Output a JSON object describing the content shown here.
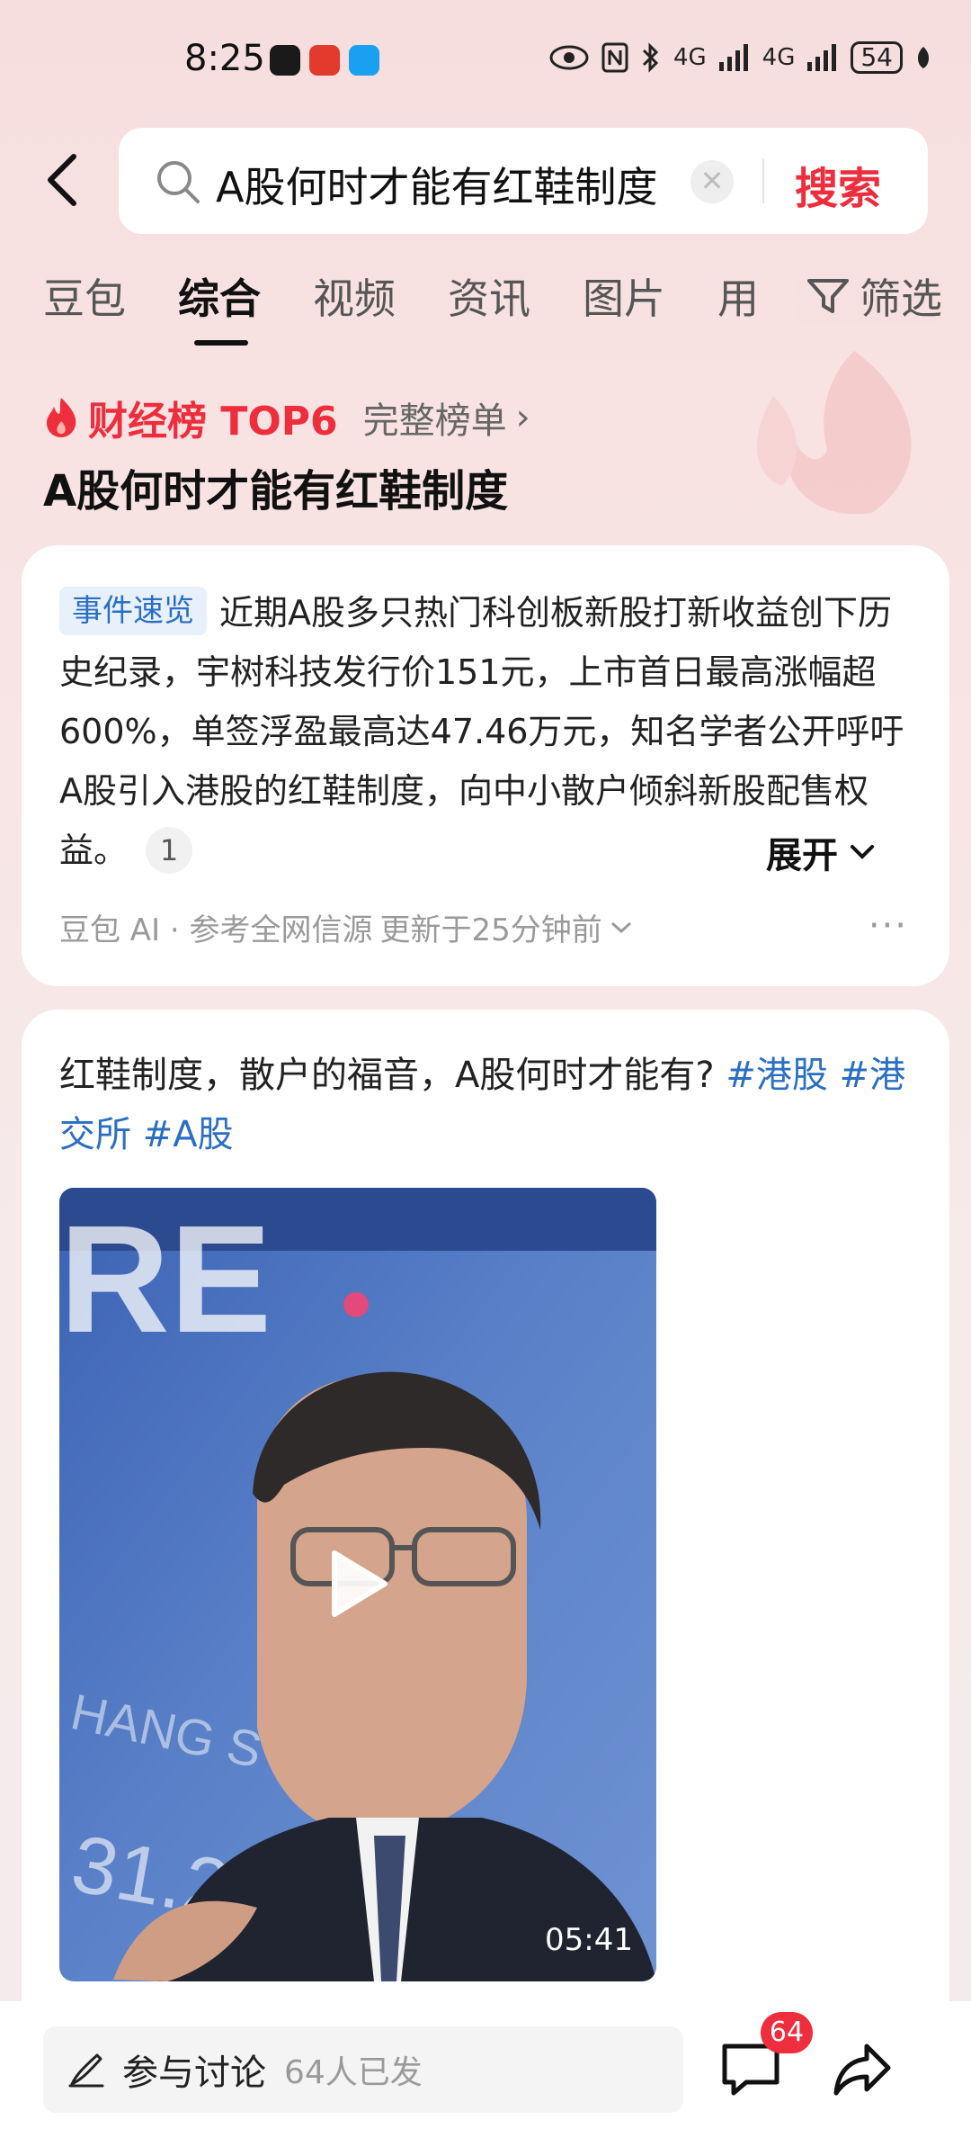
{
  "status_bar": {
    "time": "8:25",
    "network_1": "4G",
    "network_2": "4G",
    "battery": "54"
  },
  "search": {
    "query": "A股何时才能有红鞋制度",
    "submit_label": "搜索",
    "clear_icon": "close-icon"
  },
  "tabs": [
    {
      "label": "豆包",
      "active": false
    },
    {
      "label": "综合",
      "active": true
    },
    {
      "label": "视频",
      "active": false
    },
    {
      "label": "资讯",
      "active": false
    },
    {
      "label": "图片",
      "active": false
    },
    {
      "label": "用",
      "active": false
    }
  ],
  "filter": {
    "label": "筛选"
  },
  "ranking": {
    "title": "财经榜 TOP6",
    "link": "完整榜单"
  },
  "topic": {
    "title": "A股何时才能有红鞋制度"
  },
  "summary": {
    "tag": "事件速览",
    "text": "近期A股多只热门科创板新股打新收益创下历史纪录，宇树科技发行价151元，上市首日最高涨幅超600%，单签浮盈最高达47.46万元，知名学者公开呼吁A股引入港股的红鞋制度，向中小散户倾斜新股配售权益。",
    "cite": "1",
    "expand_label": "展开",
    "meta_source": "豆包 AI · 参考全网信源",
    "meta_updated": "更新于25分钟前",
    "more": "···"
  },
  "post": {
    "text": "红鞋制度，散户的福音，A股何时才能有? ",
    "hashtags": [
      "#港股",
      "#港交所",
      "#A股"
    ],
    "video_duration": "05:41"
  },
  "bottom_bar": {
    "discuss_label": "参与讨论",
    "discuss_count": "64人已发",
    "comment_badge": "64"
  },
  "colors": {
    "accent_red": "#ee2d3d",
    "link_blue": "#2a6fc3",
    "page_bg": "#f7dede"
  }
}
